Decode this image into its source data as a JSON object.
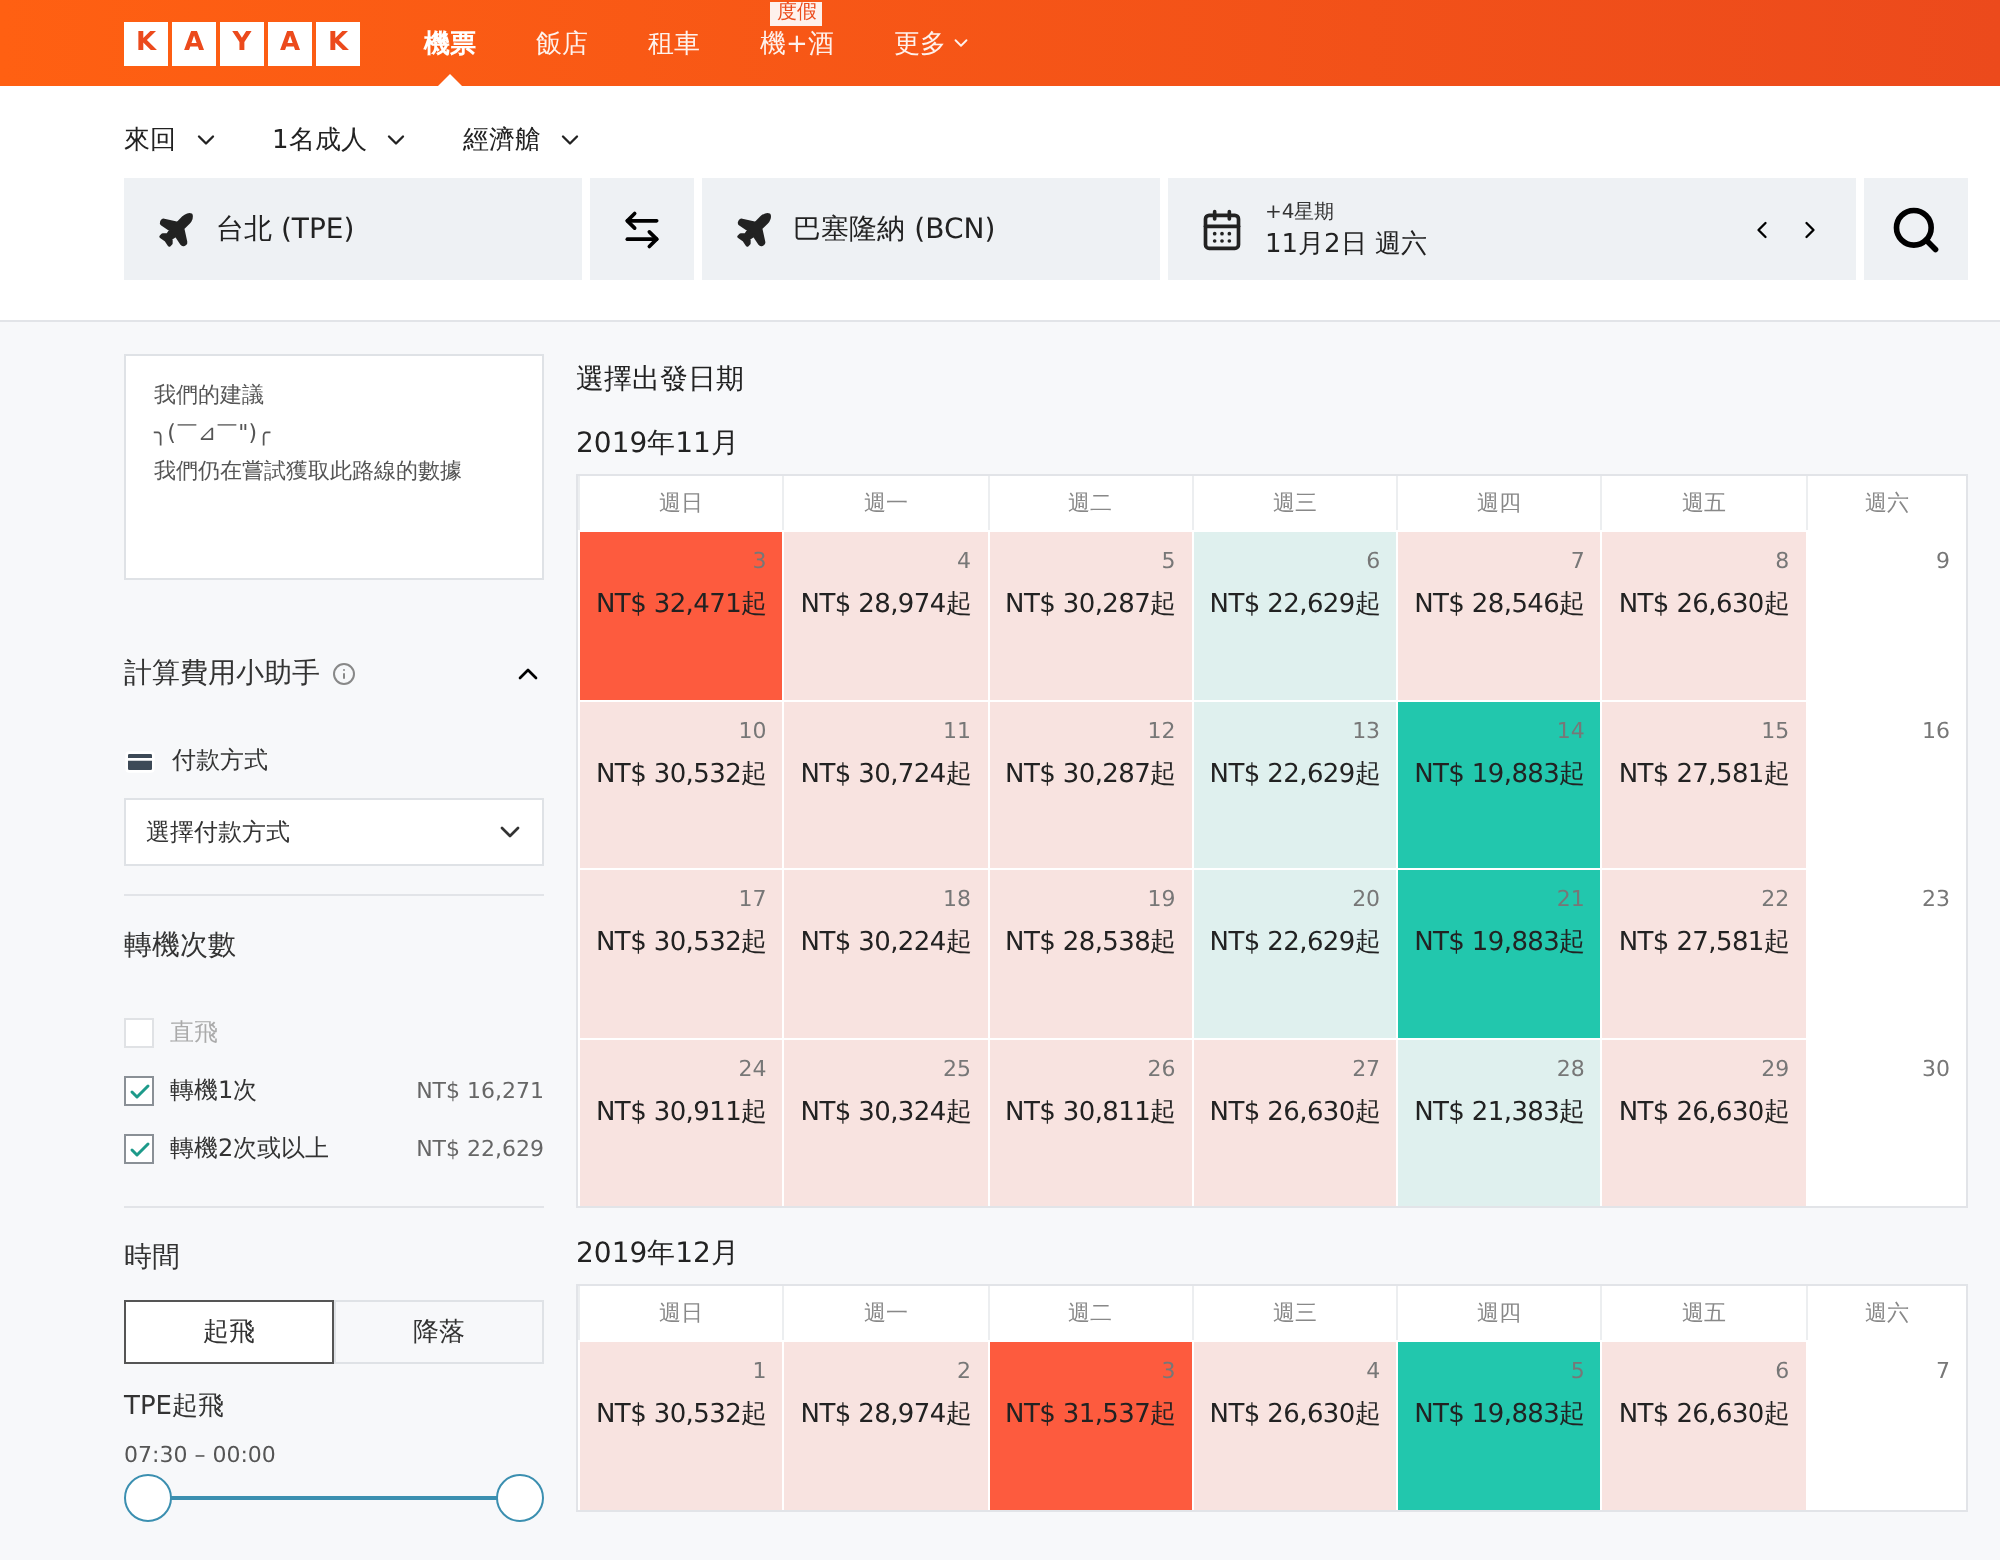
{
  "header": {
    "logo": [
      "K",
      "A",
      "Y",
      "A",
      "K"
    ],
    "nav": [
      {
        "label": "機票",
        "kind": "link",
        "selected": true
      },
      {
        "label": "飯店",
        "kind": "link",
        "selected": false
      },
      {
        "label": "租車",
        "kind": "link",
        "selected": false
      },
      {
        "label": "機+酒",
        "kind": "link",
        "badge": "度假",
        "selected": false
      },
      {
        "label": "更多",
        "kind": "menu",
        "selected": false
      }
    ]
  },
  "search": {
    "options": [
      "來回",
      "1名成人",
      "經濟艙"
    ],
    "origin": "台北 (TPE)",
    "destination": "巴塞隆納 (BCN)",
    "date": {
      "hint": "+4星期",
      "value": "11月2日 週六"
    }
  },
  "sidebar": {
    "suggestion": {
      "title": "我們的建議",
      "face": "╮(￣⊿￣\")╭",
      "message": "我們仍在嘗試獲取此路線的數據"
    },
    "fee_helper": {
      "title": "計算費用小助手",
      "expanded": true,
      "payment_label": "付款方式",
      "payment_placeholder": "選擇付款方式"
    },
    "stops": {
      "title": "轉機次數",
      "options": [
        {
          "label": "直飛",
          "checked": false,
          "disabled": true
        },
        {
          "label": "轉機1次",
          "checked": true,
          "disabled": false,
          "price": "NT$ 16,271"
        },
        {
          "label": "轉機2次或以上",
          "checked": true,
          "disabled": false,
          "price": "NT$ 22,629"
        }
      ]
    },
    "time": {
      "title": "時間",
      "tabs": [
        {
          "label": "起飛",
          "selected": true
        },
        {
          "label": "降落",
          "selected": false
        }
      ],
      "departure_label": "TPE起飛",
      "range": "07:30 – 00:00",
      "thumbs": [
        {
          "level": 0
        },
        {
          "level": 1
        }
      ]
    }
  },
  "calendar": {
    "title": "選擇出發日期",
    "months": [
      {
        "title": "2019年11月",
        "weekdays": [
          "週日",
          "週一",
          "週二",
          "週三",
          "週四",
          "週五",
          "週六"
        ],
        "weeks": [
          [
            {
              "day": "3",
              "price": "NT$ 32,471起",
              "color": "#fd5b3e"
            },
            {
              "day": "4",
              "price": "NT$ 28,974起",
              "color": "#f8e3e0"
            },
            {
              "day": "5",
              "price": "NT$ 30,287起",
              "color": "#f8e3e0"
            },
            {
              "day": "6",
              "price": "NT$ 22,629起",
              "color": "#dff0ee"
            },
            {
              "day": "7",
              "price": "NT$ 28,546起",
              "color": "#f8e3e0"
            },
            {
              "day": "8",
              "price": "NT$ 26,630起",
              "color": "#f8e3e0"
            },
            {
              "day": "9",
              "color": "#ffffff"
            }
          ],
          [
            {
              "day": "10",
              "price": "NT$ 30,532起",
              "color": "#f8e3e0"
            },
            {
              "day": "11",
              "price": "NT$ 30,724起",
              "color": "#f8e3e0"
            },
            {
              "day": "12",
              "price": "NT$ 30,287起",
              "color": "#f8e3e0"
            },
            {
              "day": "13",
              "price": "NT$ 22,629起",
              "color": "#dff0ee"
            },
            {
              "day": "14",
              "price": "NT$ 19,883起",
              "color": "#22c7ad"
            },
            {
              "day": "15",
              "price": "NT$ 27,581起",
              "color": "#f8e3e0"
            },
            {
              "day": "16",
              "color": "#ffffff"
            }
          ],
          [
            {
              "day": "17",
              "price": "NT$ 30,532起",
              "color": "#f8e3e0"
            },
            {
              "day": "18",
              "price": "NT$ 30,224起",
              "color": "#f8e3e0"
            },
            {
              "day": "19",
              "price": "NT$ 28,538起",
              "color": "#f8e3e0"
            },
            {
              "day": "20",
              "price": "NT$ 22,629起",
              "color": "#dff0ee"
            },
            {
              "day": "21",
              "price": "NT$ 19,883起",
              "color": "#22c7ad"
            },
            {
              "day": "22",
              "price": "NT$ 27,581起",
              "color": "#f8e3e0"
            },
            {
              "day": "23",
              "color": "#ffffff"
            }
          ],
          [
            {
              "day": "24",
              "price": "NT$ 30,911起",
              "color": "#f8e3e0"
            },
            {
              "day": "25",
              "price": "NT$ 30,324起",
              "color": "#f8e3e0"
            },
            {
              "day": "26",
              "price": "NT$ 30,811起",
              "color": "#f8e3e0"
            },
            {
              "day": "27",
              "price": "NT$ 26,630起",
              "color": "#f8e3e0"
            },
            {
              "day": "28",
              "price": "NT$ 21,383起",
              "color": "#dff0ee"
            },
            {
              "day": "29",
              "price": "NT$ 26,630起",
              "color": "#f8e3e0"
            },
            {
              "day": "30",
              "color": "#ffffff"
            }
          ]
        ]
      },
      {
        "title": "2019年12月",
        "weekdays": [
          "週日",
          "週一",
          "週二",
          "週三",
          "週四",
          "週五",
          "週六"
        ],
        "weeks": [
          [
            {
              "day": "1",
              "price": "NT$ 30,532起",
              "color": "#f8e3e0"
            },
            {
              "day": "2",
              "price": "NT$ 28,974起",
              "color": "#f8e3e0"
            },
            {
              "day": "3",
              "price": "NT$ 31,537起",
              "color": "#fd5b3e"
            },
            {
              "day": "4",
              "price": "NT$ 26,630起",
              "color": "#f8e3e0"
            },
            {
              "day": "5",
              "price": "NT$ 19,883起",
              "color": "#22c7ad"
            },
            {
              "day": "6",
              "price": "NT$ 26,630起",
              "color": "#f8e3e0"
            },
            {
              "day": "7",
              "color": "#ffffff"
            }
          ]
        ]
      }
    ]
  }
}
